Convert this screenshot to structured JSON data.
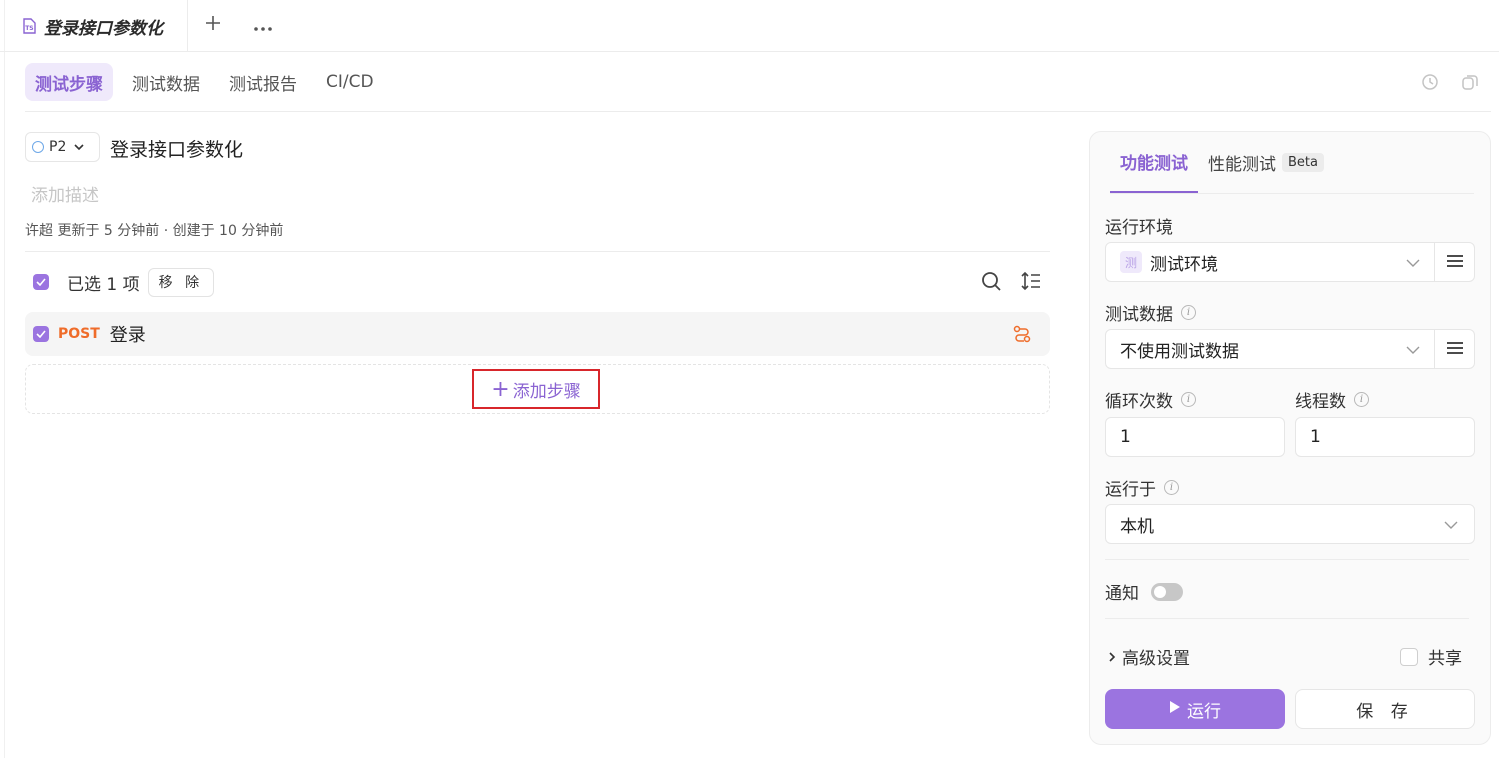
{
  "file_tab": {
    "title": "登录接口参数化",
    "icon": "ts-file-icon"
  },
  "toolbar": {
    "new_tab_icon": "plus-icon",
    "more_icon": "more-horizontal-icon"
  },
  "tabs": [
    {
      "label": "测试步骤",
      "active": true
    },
    {
      "label": "测试数据",
      "active": false
    },
    {
      "label": "测试报告",
      "active": false
    },
    {
      "label": "CI/CD",
      "active": false
    }
  ],
  "header_icons": [
    "history-icon",
    "copy-icon"
  ],
  "case": {
    "priority": "P2",
    "title": "登录接口参数化",
    "description_placeholder": "添加描述",
    "meta": "许超 更新于 5 分钟前 · 创建于 10 分钟前"
  },
  "selection": {
    "text": "已选 1 项",
    "remove_label": "移 除"
  },
  "steps": [
    {
      "method": "POST",
      "name": "登录",
      "checked": true
    }
  ],
  "add_step_label": "添加步骤",
  "panel": {
    "tabs": [
      {
        "label": "功能测试",
        "active": true
      },
      {
        "label": "性能测试",
        "badge": "Beta",
        "active": false
      }
    ],
    "env": {
      "label": "运行环境",
      "badge": "测",
      "value": "测试环境"
    },
    "test_data": {
      "label": "测试数据",
      "value": "不使用测试数据"
    },
    "loops": {
      "label": "循环次数",
      "value": "1"
    },
    "threads": {
      "label": "线程数",
      "value": "1"
    },
    "run_on": {
      "label": "运行于",
      "value": "本机"
    },
    "notify": {
      "label": "通知",
      "enabled": false
    },
    "advanced_label": "高级设置",
    "share_label": "共享",
    "run_label": "运行",
    "save_label": "保 存"
  },
  "colors": {
    "accent": "#8a63d2",
    "accent_light": "#efe9fb",
    "post": "#ef6c2a",
    "highlight_box": "#d8262b"
  }
}
